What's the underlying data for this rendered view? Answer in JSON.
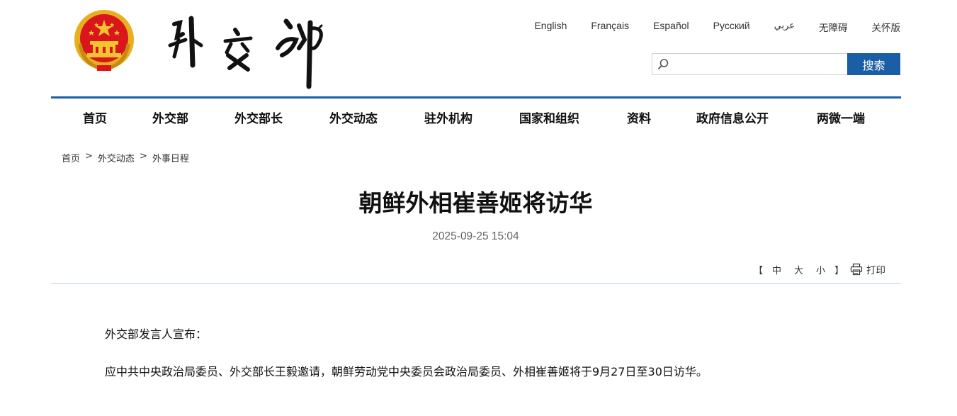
{
  "header": {
    "emblem_icon": "national-emblem-icon",
    "calligraphy_text": "外交部",
    "languages": [
      "English",
      "Français",
      "Español",
      "Русский",
      "عربي",
      "无障碍",
      "关怀版"
    ]
  },
  "search": {
    "placeholder": "",
    "value": "",
    "button_label": "搜索",
    "icon": "search-icon"
  },
  "nav": {
    "items": [
      "首页",
      "外交部",
      "外交部长",
      "外交动态",
      "驻外机构",
      "国家和组织",
      "资料",
      "政府信息公开",
      "两微一端"
    ]
  },
  "breadcrumb": {
    "items": [
      "首页",
      "外交动态",
      "外事日程"
    ],
    "separator": ">"
  },
  "article": {
    "title": "朝鲜外相崔善姬将访华",
    "date": "2025-09-25 15:04",
    "font_sizes": {
      "open_bracket": "【",
      "large": "中",
      "medium": "大",
      "small": "小",
      "close_bracket": "】"
    },
    "print_label": "打印",
    "paragraphs": [
      "外交部发言人宣布：",
      "应中共中央政治局委员、外交部长王毅邀请，朝鲜劳动党中央委员会政治局委员、外相崔善姬将于9月27日至30日访华。"
    ]
  },
  "colors": {
    "accent": "#1a5fa6",
    "emblem_red": "#d8161b",
    "emblem_gold": "#e8b01f"
  }
}
